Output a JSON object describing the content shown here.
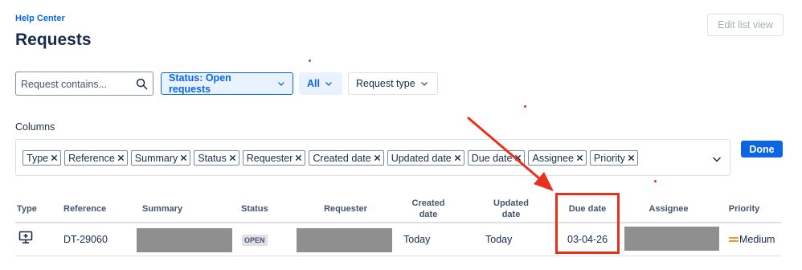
{
  "header": {
    "breadcrumb": "Help Center",
    "title": "Requests",
    "edit_button": "Edit list view"
  },
  "filters": {
    "search_placeholder": "Request contains...",
    "status_label": "Status: Open requests",
    "all_label": "All",
    "request_type_label": "Request type"
  },
  "columns_section": {
    "label": "Columns",
    "chips": [
      "Type",
      "Reference",
      "Summary",
      "Status",
      "Requester",
      "Created date",
      "Updated date",
      "Due date",
      "Assignee",
      "Priority"
    ],
    "done_button": "Done"
  },
  "table": {
    "headers": {
      "type": "Type",
      "reference": "Reference",
      "summary": "Summary",
      "status": "Status",
      "requester": "Requester",
      "created_date": "Created date",
      "updated_date": "Updated date",
      "due_date": "Due date",
      "assignee": "Assignee",
      "priority": "Priority"
    },
    "rows": [
      {
        "type_icon": "computer-support-icon",
        "reference": "DT-29060",
        "status": "OPEN",
        "created_date": "Today",
        "updated_date": "Today",
        "due_date": "03-04-26",
        "priority": "Medium"
      }
    ]
  },
  "colors": {
    "accent": "#0c66e4",
    "annotation": "#e8301d",
    "priority_medium": "#f18d13"
  }
}
